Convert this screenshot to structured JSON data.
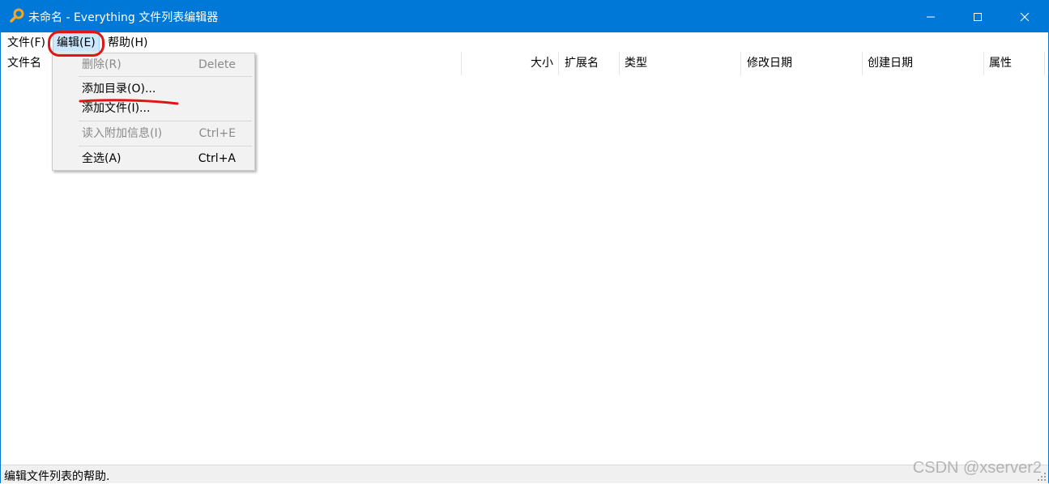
{
  "window": {
    "title": "未命名 - Everything 文件列表编辑器"
  },
  "menubar": {
    "file": "文件(F)",
    "edit": "编辑(E)",
    "help": "帮助(H)"
  },
  "columns": {
    "name": "文件名",
    "size": "大小",
    "ext": "扩展名",
    "type": "类型",
    "modified": "修改日期",
    "created": "创建日期",
    "attributes": "属性"
  },
  "edit_menu": {
    "delete": {
      "label": "删除(R)",
      "shortcut": "Delete"
    },
    "add_folder": {
      "label": "添加目录(O)..."
    },
    "add_file": {
      "label": "添加文件(I)..."
    },
    "read_info": {
      "label": "读入附加信息(I)",
      "shortcut": "Ctrl+E"
    },
    "select_all": {
      "label": "全选(A)",
      "shortcut": "Ctrl+A"
    }
  },
  "status": {
    "text": "编辑文件列表的帮助."
  },
  "watermark": "CSDN @xserver2",
  "colors": {
    "accent": "#0078d7",
    "annotation": "#e01515",
    "menu_highlight": "#cce8ff"
  }
}
